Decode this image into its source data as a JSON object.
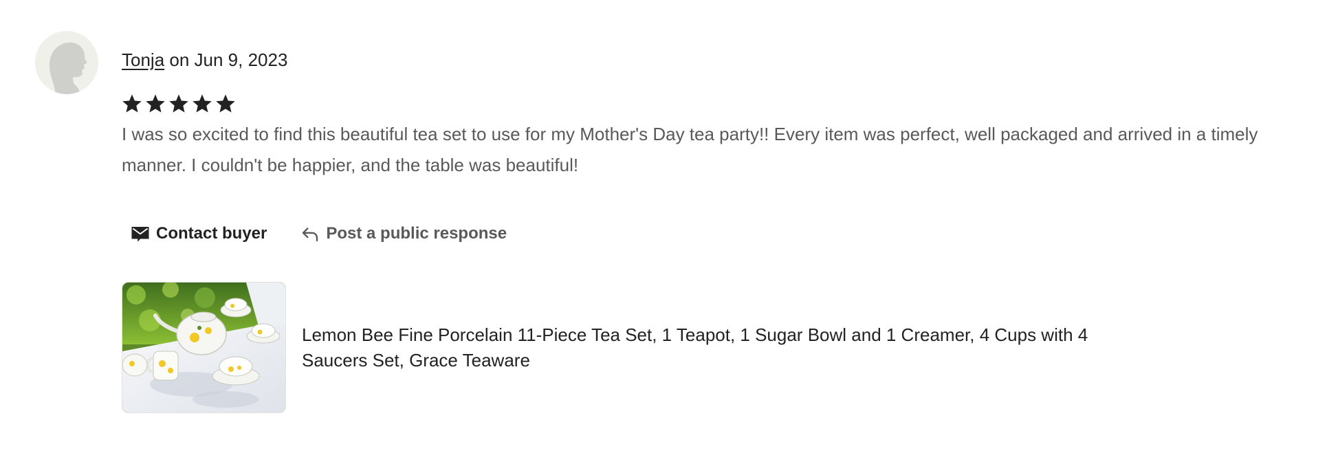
{
  "review": {
    "reviewer_name": "Tonja",
    "date_text": " on Jun 9, 2023",
    "rating": 5,
    "rating_max": 5,
    "star_icon": "star-icon",
    "text": "I was so excited to find this beautiful tea set to use for my Mother's Day tea party!! Every item was perfect, well packaged and arrived in a timely manner. I couldn't be happier, and the table was beautiful!"
  },
  "actions": {
    "contact_label": "Contact buyer",
    "contact_icon": "envelope-icon",
    "respond_label": "Post a public response",
    "respond_icon": "reply-arrow-icon"
  },
  "listing": {
    "title": "Lemon Bee Fine Porcelain 11-Piece Tea Set, 1 Teapot, 1 Sugar Bowl and 1 Creamer, 4 Cups with 4 Saucers Set, Grace Teaware"
  },
  "colors": {
    "text_primary": "#222222",
    "text_secondary": "#595959",
    "star": "#222222",
    "avatar_bg": "#f0f0ea",
    "avatar_silhouette": "#cfcfcb"
  }
}
